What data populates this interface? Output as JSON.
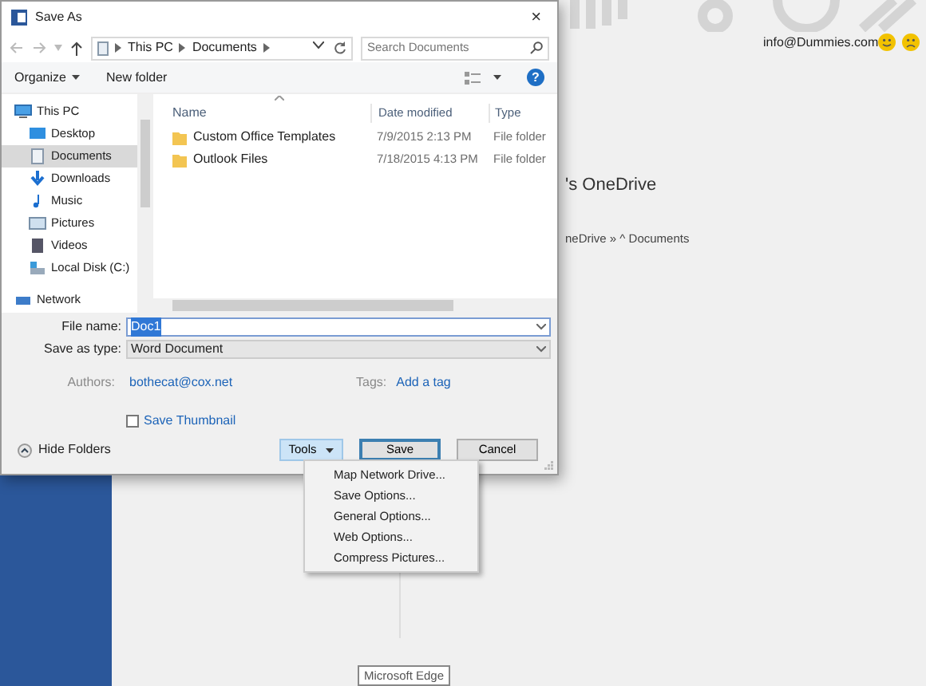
{
  "backstage": {
    "account_email": "info@Dummies.com",
    "onedrive_title": "'s OneDrive",
    "onedrive_path": "neDrive » ^ Documents",
    "tooltip": "Microsoft Edge"
  },
  "dialog": {
    "title": "Save As",
    "close": "×",
    "breadcrumb": [
      "This PC",
      "Documents"
    ],
    "search_placeholder": "Search Documents",
    "toolbar": [
      "Organize",
      "New folder"
    ],
    "help": "?",
    "nav_items": [
      {
        "label": "This PC",
        "kind": "pc",
        "selected": false
      },
      {
        "label": "Desktop",
        "kind": "desktop",
        "selected": false
      },
      {
        "label": "Documents",
        "kind": "documents",
        "selected": true
      },
      {
        "label": "Downloads",
        "kind": "downloads",
        "selected": false
      },
      {
        "label": "Music",
        "kind": "music",
        "selected": false
      },
      {
        "label": "Pictures",
        "kind": "pictures",
        "selected": false
      },
      {
        "label": "Videos",
        "kind": "videos",
        "selected": false
      },
      {
        "label": "Local Disk (C:)",
        "kind": "disk",
        "selected": false
      },
      {
        "label": "Network",
        "kind": "network",
        "selected": false
      }
    ],
    "columns": [
      "Name",
      "Date modified",
      "Type"
    ],
    "files": [
      {
        "name": "Custom Office Templates",
        "date": "7/9/2015 2:13 PM",
        "type": "File folder"
      },
      {
        "name": "Outlook Files",
        "date": "7/18/2015 4:13 PM",
        "type": "File folder"
      }
    ],
    "file_name_label": "File name:",
    "file_name": "Doc1",
    "save_type_label": "Save as type:",
    "save_type": "Word Document",
    "authors_label": "Authors:",
    "authors": "bothecat@cox.net",
    "tags_label": "Tags:",
    "tags": "Add a tag",
    "save_thumbnail": {
      "label": "Save Thumbnail",
      "checked": false
    },
    "hide_folders": "Hide Folders",
    "buttons": [
      {
        "label": "Tools",
        "kind": "tools",
        "expanded": true
      },
      {
        "label": "Save",
        "kind": "save"
      },
      {
        "label": "Cancel",
        "kind": "cancel"
      }
    ],
    "tools_menu": [
      "Map Network Drive...",
      "Save Options...",
      "General Options...",
      "Web Options...",
      "Compress Pictures..."
    ]
  }
}
